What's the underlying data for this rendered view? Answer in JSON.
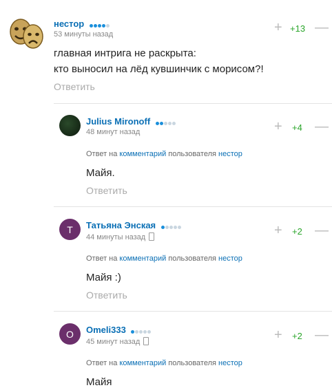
{
  "comments": [
    {
      "author": "нестор",
      "time": "53 минуты назад",
      "score": "+13",
      "lines": [
        "главная интрига не раскрыта:",
        "кто выносил на лёд кувшинчик с морисом?!"
      ],
      "reply_label": "Ответить",
      "rating_dots": 4,
      "avatar": "theater-masks"
    },
    {
      "author": "Julius Mironoff",
      "time": "48 минут назад",
      "score": "+4",
      "reply_to": {
        "prefix": "Ответ на",
        "link": "комментарий",
        "mid": "пользователя",
        "user": "нестор"
      },
      "text": "Майя.",
      "reply_label": "Ответить",
      "rating_dots": 2,
      "avatar": "dark-photo"
    },
    {
      "author": "Татьяна Энская",
      "time": "44 минуты назад",
      "score": "+2",
      "reply_to": {
        "prefix": "Ответ на",
        "link": "комментарий",
        "mid": "пользователя",
        "user": "нестор"
      },
      "text": "Майя :)",
      "reply_label": "Ответить",
      "rating_dots": 1,
      "avatar_letter": "Т",
      "avatar_color": "#6b2f6b"
    },
    {
      "author": "Omeli333",
      "time": "45 минут назад",
      "score": "+2",
      "reply_to": {
        "prefix": "Ответ на",
        "link": "комментарий",
        "mid": "пользователя",
        "user": "нестор"
      },
      "text": "Майя",
      "rating_dots": 1,
      "avatar_letter": "O",
      "avatar_color": "#6b2f6b"
    }
  ],
  "colors": {
    "author": "#0a6fb5",
    "score": "#2aa52a",
    "muted": "#aaaaaa"
  }
}
